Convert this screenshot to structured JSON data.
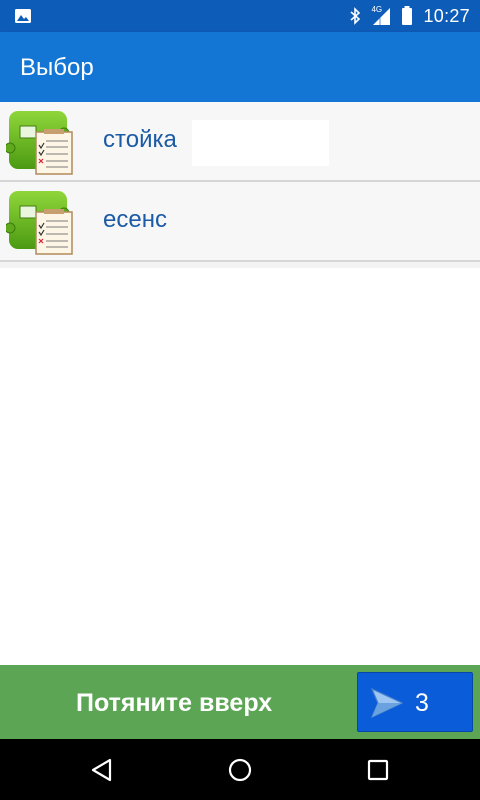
{
  "status_bar": {
    "time": "10:27",
    "network": "4G",
    "icons": [
      "image-notification-icon",
      "bluetooth-icon",
      "signal-icon",
      "battery-icon"
    ]
  },
  "app_bar": {
    "title": "Выбор"
  },
  "list": {
    "items": [
      {
        "label": "стойка",
        "icon": "checklist-app-icon"
      },
      {
        "label": "есенс",
        "icon": "checklist-app-icon"
      }
    ]
  },
  "bottom_bar": {
    "pull_up_label": "Потяните вверх",
    "send_count": "3",
    "send_icon": "send-icon"
  },
  "nav_bar": {
    "buttons": [
      "back-icon",
      "home-icon",
      "recents-icon"
    ]
  },
  "colors": {
    "status_bar": "#0d5cb8",
    "app_bar": "#1376d4",
    "item_text": "#1b5aa6",
    "bottom_bar": "#5ba554",
    "send_button": "#0a5cd9"
  }
}
